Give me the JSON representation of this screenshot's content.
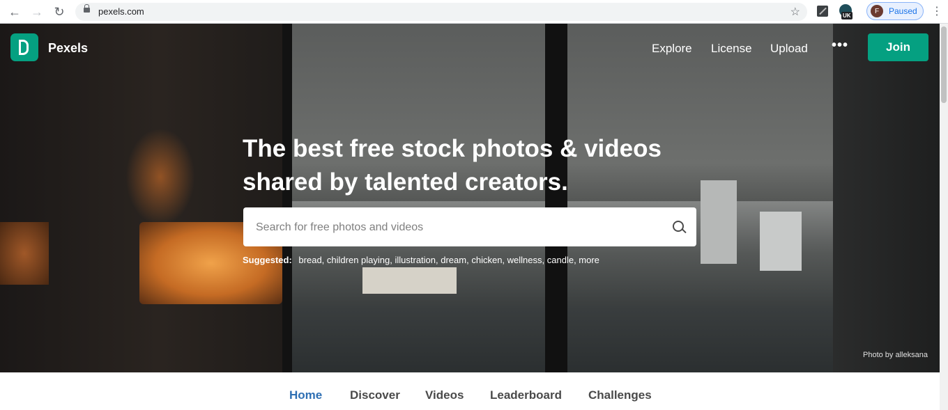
{
  "browser": {
    "url": "pexels.com",
    "profile_initial": "F",
    "profile_status": "Paused",
    "extension_badge": "UK"
  },
  "header": {
    "brand": "Pexels",
    "nav": [
      "Explore",
      "License",
      "Upload"
    ],
    "more_label": "•••",
    "join_label": "Join"
  },
  "hero": {
    "headline_line1": "The best free stock photos & videos",
    "headline_line2": "shared by talented creators.",
    "search_placeholder": "Search for free photos and videos",
    "suggested_label": "Suggested:",
    "suggestions": [
      "bread",
      "children playing",
      "illustration",
      "dream",
      "chicken",
      "wellness",
      "candle",
      "more"
    ],
    "credit": "Photo by alleksana"
  },
  "tabs": [
    "Home",
    "Discover",
    "Videos",
    "Leaderboard",
    "Challenges"
  ],
  "colors": {
    "accent": "#05a081",
    "active_tab": "#2e6fb3"
  }
}
